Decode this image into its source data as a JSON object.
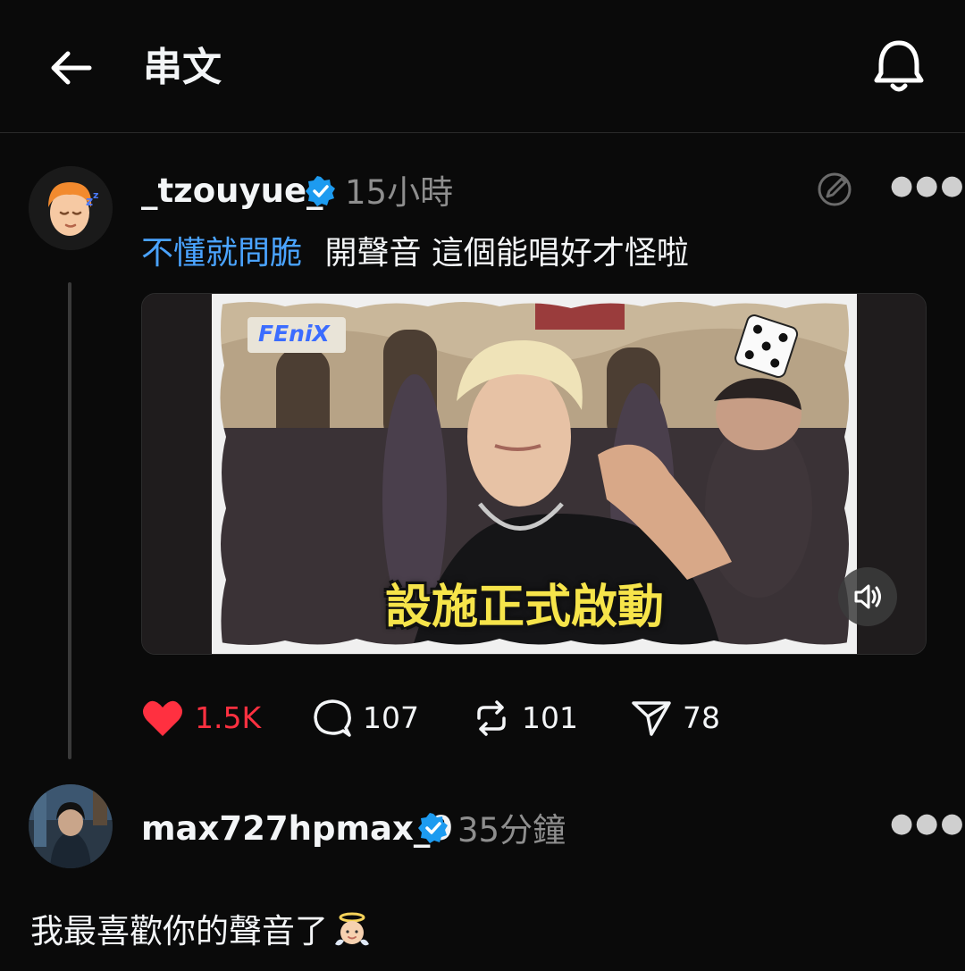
{
  "header": {
    "title": "串文"
  },
  "post": {
    "username": "_tzouyue_",
    "time": "15小時",
    "hashtag": "不懂就問脆",
    "text": "開聲音 這個能唱好才怪啦",
    "video_overlay": {
      "logo": "FEniX",
      "subtitle": "設施正式啟動"
    },
    "stats": {
      "likes": "1.5K",
      "comments": "107",
      "reposts": "101",
      "shares": "78"
    }
  },
  "reply": {
    "username": "max727hpmax_9",
    "time": "35分鐘",
    "text": "我最喜歡你的聲音了"
  },
  "colors": {
    "accent_blue": "#4aa3ff",
    "like_red": "#ff3040",
    "verified_blue": "#1d9bf0"
  }
}
